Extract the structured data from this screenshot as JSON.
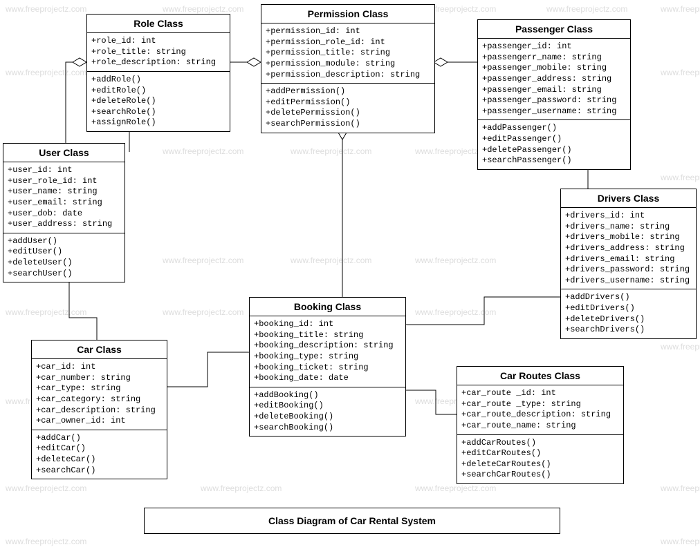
{
  "diagram_title": "Class Diagram of Car Rental System",
  "watermark": "www.freeprojectz.com",
  "classes": {
    "role": {
      "title": "Role Class",
      "attrs": [
        "+role_id: int",
        "+role_title: string",
        "+role_description: string"
      ],
      "ops": [
        "+addRole()",
        "+editRole()",
        "+deleteRole()",
        "+searchRole()",
        "+assignRole()"
      ]
    },
    "permission": {
      "title": "Permission Class",
      "attrs": [
        "+permission_id: int",
        "+permission_role_id: int",
        "+permission_title: string",
        "+permission_module: string",
        "+permission_description: string"
      ],
      "ops": [
        "+addPermission()",
        "+editPermission()",
        "+deletePermission()",
        "+searchPermission()"
      ]
    },
    "passenger": {
      "title": "Passenger Class",
      "attrs": [
        "+passenger_id: int",
        "+passengerr_name: string",
        "+passenger_mobile: string",
        "+passenger_address: string",
        "+passenger_email: string",
        "+passenger_password: string",
        "+passenger_username: string"
      ],
      "ops": [
        "+addPassenger()",
        "+editPassenger()",
        "+deletePassenger()",
        "+searchPassenger()"
      ]
    },
    "user": {
      "title": "User Class",
      "attrs": [
        "+user_id: int",
        "+user_role_id: int",
        "+user_name: string",
        "+user_email: string",
        "+user_dob: date",
        "+user_address: string"
      ],
      "ops": [
        "+addUser()",
        "+editUser()",
        "+deleteUser()",
        "+searchUser()"
      ]
    },
    "drivers": {
      "title": "Drivers Class",
      "attrs": [
        "+drivers_id: int",
        "+drivers_name: string",
        "+drivers_mobile: string",
        "+drivers_address: string",
        "+drivers_email: string",
        "+drivers_password: string",
        "+drivers_username: string"
      ],
      "ops": [
        "+addDrivers()",
        "+editDrivers()",
        "+deleteDrivers()",
        "+searchDrivers()"
      ]
    },
    "booking": {
      "title": "Booking Class",
      "attrs": [
        "+booking_id: int",
        "+booking_title: string",
        "+booking_description: string",
        "+booking_type: string",
        "+booking_ticket: string",
        "+booking_date: date"
      ],
      "ops": [
        "+addBooking()",
        "+editBooking()",
        "+deleteBooking()",
        "+searchBooking()"
      ]
    },
    "car": {
      "title": "Car Class",
      "attrs": [
        "+car_id: int",
        "+car_number: string",
        "+car_type: string",
        "+car_category: string",
        "+car_description: string",
        "+car_owner_id: int"
      ],
      "ops": [
        "+addCar()",
        "+editCar()",
        "+deleteCar()",
        "+searchCar()"
      ]
    },
    "carroutes": {
      "title": "Car Routes Class",
      "attrs": [
        "+car_route _id: int",
        "+car_route _type: string",
        "+car_route_description: string",
        "+car_route_name: string"
      ],
      "ops": [
        "+addCarRoutes()",
        "+editCarRoutes()",
        "+deleteCarRoutes()",
        "+searchCarRoutes()"
      ]
    }
  },
  "chart_data": {
    "type": "uml-class-diagram",
    "classes": [
      "Role",
      "Permission",
      "Passenger",
      "User",
      "Drivers",
      "Booking",
      "Car",
      "Car Routes"
    ],
    "relationships": [
      {
        "from": "User",
        "to": "Role",
        "type": "aggregation",
        "end": "Role"
      },
      {
        "from": "Role",
        "to": "Permission",
        "type": "aggregation",
        "end": "Permission"
      },
      {
        "from": "Permission",
        "to": "Passenger",
        "type": "aggregation",
        "end": "Passenger"
      },
      {
        "from": "Permission",
        "to": "Booking",
        "type": "aggregation",
        "end": "Permission"
      },
      {
        "from": "Passenger",
        "to": "Drivers",
        "type": "association"
      },
      {
        "from": "Booking",
        "to": "Drivers",
        "type": "association"
      },
      {
        "from": "Booking",
        "to": "Car Routes",
        "type": "association"
      },
      {
        "from": "Car",
        "to": "Booking",
        "type": "association"
      },
      {
        "from": "User",
        "to": "Car",
        "type": "association"
      }
    ]
  }
}
